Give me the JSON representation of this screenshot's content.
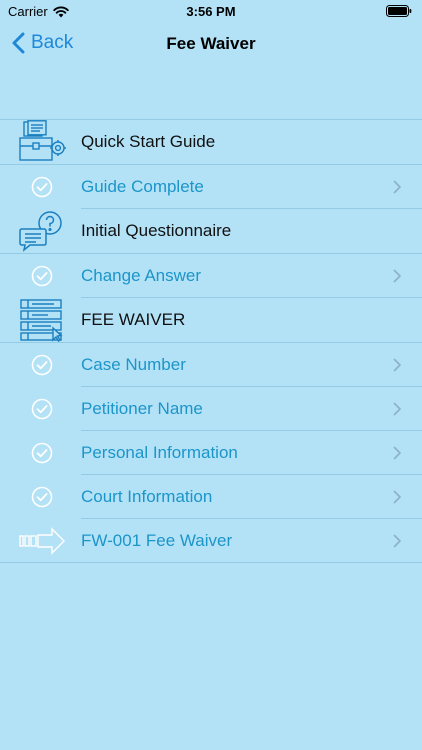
{
  "status": {
    "carrier": "Carrier",
    "time": "3:56 PM"
  },
  "nav": {
    "back_label": "Back",
    "title": "Fee Waiver"
  },
  "colors": {
    "accent": "#1e88d8",
    "link": "#1c95c9",
    "background": "#b3e2f7"
  },
  "rows": [
    {
      "label": "Quick Start Guide",
      "kind": "section",
      "icon": "briefcase-documents-icon"
    },
    {
      "label": "Guide Complete",
      "kind": "item",
      "icon": "check-circle-icon"
    },
    {
      "label": "Initial Questionnaire",
      "kind": "section",
      "icon": "question-chat-icon"
    },
    {
      "label": "Change Answer",
      "kind": "item",
      "icon": "check-circle-icon"
    },
    {
      "label": "FEE WAIVER",
      "kind": "section",
      "icon": "form-fields-icon"
    },
    {
      "label": "Case Number",
      "kind": "item",
      "icon": "check-circle-icon"
    },
    {
      "label": "Petitioner Name",
      "kind": "item",
      "icon": "check-circle-icon"
    },
    {
      "label": "Personal Information",
      "kind": "item",
      "icon": "check-circle-icon"
    },
    {
      "label": "Court Information",
      "kind": "item",
      "icon": "check-circle-icon"
    },
    {
      "label": "FW-001 Fee Waiver",
      "kind": "item",
      "icon": "arrow-right-outline-icon"
    }
  ]
}
